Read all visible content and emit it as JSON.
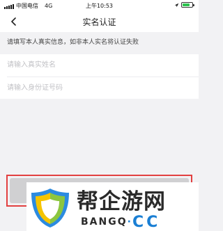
{
  "status_bar": {
    "carrier": "中国电信",
    "network": "4G",
    "time": "上午10:53",
    "battery_level": 0.75,
    "battery_color": "#2dc34e"
  },
  "nav": {
    "title": "实名认证",
    "back_icon": "chevron-left-icon"
  },
  "notice": {
    "text": "请填写本人真实信息，如非本人实名将认证失败"
  },
  "form": {
    "name_placeholder": "请输入真实姓名",
    "id_placeholder": "请输入身份证号码",
    "name_value": "",
    "id_value": ""
  },
  "submit": {
    "label": "",
    "disabled_color": "#d0d0d2",
    "highlight_color": "#e24040"
  },
  "watermark": {
    "title": "帮企游网",
    "domain_prefix": "BANGQ",
    "domain_sep": "·",
    "domain_suffix": "CC",
    "logo_icon": "shield-logo-icon"
  }
}
